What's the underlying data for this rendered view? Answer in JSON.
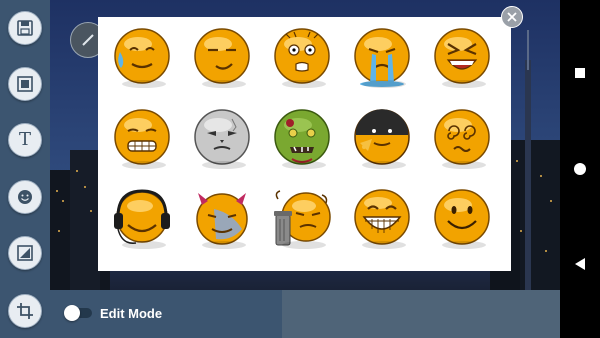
{
  "toolbar": {
    "tools": [
      {
        "name": "save-icon"
      },
      {
        "name": "image-icon"
      },
      {
        "name": "text-icon",
        "glyph": "T"
      },
      {
        "name": "sticker-icon"
      },
      {
        "name": "frame-icon"
      },
      {
        "name": "crop-icon"
      }
    ]
  },
  "bottom_bar": {
    "edit_mode_label": "Edit Mode",
    "edit_mode_on": false
  },
  "sticker_panel": {
    "close_icon": "close-icon",
    "stickers": [
      {
        "name": "sweating-smiley",
        "body": "#f2a300",
        "row": 0,
        "col": 0
      },
      {
        "name": "winking-smiley",
        "body": "#f2a300",
        "row": 0,
        "col": 1
      },
      {
        "name": "shocked-smiley",
        "body": "#f2a300",
        "row": 0,
        "col": 2
      },
      {
        "name": "crying-smiley",
        "body": "#f2a300",
        "row": 0,
        "col": 3
      },
      {
        "name": "laughing-smiley",
        "body": "#f2a300",
        "row": 0,
        "col": 4
      },
      {
        "name": "grinning-smiley",
        "body": "#f2a300",
        "row": 1,
        "col": 0
      },
      {
        "name": "skull-smiley",
        "body": "#c8c8c8",
        "row": 1,
        "col": 1
      },
      {
        "name": "zombie-smiley",
        "body": "#7aa830",
        "row": 1,
        "col": 2
      },
      {
        "name": "eating-smiley",
        "body": "#f2a300",
        "row": 1,
        "col": 3
      },
      {
        "name": "dizzy-smiley",
        "body": "#f2a300",
        "row": 1,
        "col": 4
      },
      {
        "name": "headphones-smiley",
        "body": "#f2a300",
        "row": 2,
        "col": 0
      },
      {
        "name": "devil-smiley",
        "body": "#f2a300",
        "row": 2,
        "col": 1
      },
      {
        "name": "trash-can-smiley",
        "body": "#f2a300",
        "row": 2,
        "col": 2
      },
      {
        "name": "big-grin-smiley",
        "body": "#f2a300",
        "row": 2,
        "col": 3
      },
      {
        "name": "happy-smiley",
        "body": "#f2a300",
        "row": 2,
        "col": 4
      }
    ]
  },
  "android_nav": {
    "buttons": [
      "recents-square",
      "home-circle",
      "back-triangle"
    ]
  },
  "colors": {
    "toolbar": "#3c5570",
    "panel": "#ffffff",
    "smiley_orange": "#f2a300"
  }
}
